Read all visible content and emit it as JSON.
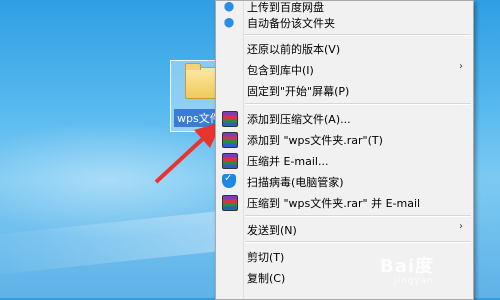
{
  "desktop": {
    "folder_label": "wps文件夹"
  },
  "context_menu": {
    "items": [
      {
        "label": "上传到百度网盘",
        "icon": "cloud-icon"
      },
      {
        "label": "自动备份该文件夹",
        "icon": "cloud-icon"
      },
      {
        "label": "还原以前的版本(V)",
        "icon": ""
      },
      {
        "label": "包含到库中(I)",
        "icon": "",
        "submenu": "›"
      },
      {
        "label": "固定到\"开始\"屏幕(P)",
        "icon": ""
      },
      {
        "label": "添加到压缩文件(A)...",
        "icon": "winrar-icon"
      },
      {
        "label": "添加到 \"wps文件夹.rar\"(T)",
        "icon": "winrar-icon"
      },
      {
        "label": "压缩并 E-mail...",
        "icon": "winrar-icon"
      },
      {
        "label": "扫描病毒(电脑管家)",
        "icon": "shield-icon"
      },
      {
        "label": "压缩到 \"wps文件夹.rar\" 并 E-mail",
        "icon": "winrar-icon"
      },
      {
        "label": "发送到(N)",
        "icon": "",
        "submenu": "›"
      },
      {
        "label": "剪切(T)",
        "icon": ""
      },
      {
        "label": "复制(C)",
        "icon": ""
      }
    ]
  },
  "watermark": {
    "text": "Bai度",
    "sub": "jingyan"
  }
}
